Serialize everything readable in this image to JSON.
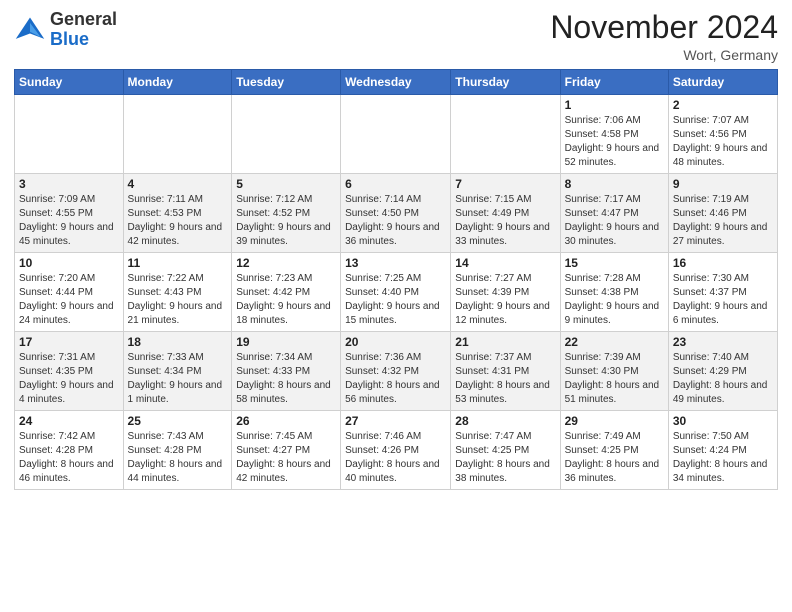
{
  "header": {
    "logo_general": "General",
    "logo_blue": "Blue",
    "month": "November 2024",
    "location": "Wort, Germany"
  },
  "days_of_week": [
    "Sunday",
    "Monday",
    "Tuesday",
    "Wednesday",
    "Thursday",
    "Friday",
    "Saturday"
  ],
  "weeks": [
    [
      {
        "day": "",
        "info": ""
      },
      {
        "day": "",
        "info": ""
      },
      {
        "day": "",
        "info": ""
      },
      {
        "day": "",
        "info": ""
      },
      {
        "day": "",
        "info": ""
      },
      {
        "day": "1",
        "info": "Sunrise: 7:06 AM\nSunset: 4:58 PM\nDaylight: 9 hours and 52 minutes."
      },
      {
        "day": "2",
        "info": "Sunrise: 7:07 AM\nSunset: 4:56 PM\nDaylight: 9 hours and 48 minutes."
      }
    ],
    [
      {
        "day": "3",
        "info": "Sunrise: 7:09 AM\nSunset: 4:55 PM\nDaylight: 9 hours and 45 minutes."
      },
      {
        "day": "4",
        "info": "Sunrise: 7:11 AM\nSunset: 4:53 PM\nDaylight: 9 hours and 42 minutes."
      },
      {
        "day": "5",
        "info": "Sunrise: 7:12 AM\nSunset: 4:52 PM\nDaylight: 9 hours and 39 minutes."
      },
      {
        "day": "6",
        "info": "Sunrise: 7:14 AM\nSunset: 4:50 PM\nDaylight: 9 hours and 36 minutes."
      },
      {
        "day": "7",
        "info": "Sunrise: 7:15 AM\nSunset: 4:49 PM\nDaylight: 9 hours and 33 minutes."
      },
      {
        "day": "8",
        "info": "Sunrise: 7:17 AM\nSunset: 4:47 PM\nDaylight: 9 hours and 30 minutes."
      },
      {
        "day": "9",
        "info": "Sunrise: 7:19 AM\nSunset: 4:46 PM\nDaylight: 9 hours and 27 minutes."
      }
    ],
    [
      {
        "day": "10",
        "info": "Sunrise: 7:20 AM\nSunset: 4:44 PM\nDaylight: 9 hours and 24 minutes."
      },
      {
        "day": "11",
        "info": "Sunrise: 7:22 AM\nSunset: 4:43 PM\nDaylight: 9 hours and 21 minutes."
      },
      {
        "day": "12",
        "info": "Sunrise: 7:23 AM\nSunset: 4:42 PM\nDaylight: 9 hours and 18 minutes."
      },
      {
        "day": "13",
        "info": "Sunrise: 7:25 AM\nSunset: 4:40 PM\nDaylight: 9 hours and 15 minutes."
      },
      {
        "day": "14",
        "info": "Sunrise: 7:27 AM\nSunset: 4:39 PM\nDaylight: 9 hours and 12 minutes."
      },
      {
        "day": "15",
        "info": "Sunrise: 7:28 AM\nSunset: 4:38 PM\nDaylight: 9 hours and 9 minutes."
      },
      {
        "day": "16",
        "info": "Sunrise: 7:30 AM\nSunset: 4:37 PM\nDaylight: 9 hours and 6 minutes."
      }
    ],
    [
      {
        "day": "17",
        "info": "Sunrise: 7:31 AM\nSunset: 4:35 PM\nDaylight: 9 hours and 4 minutes."
      },
      {
        "day": "18",
        "info": "Sunrise: 7:33 AM\nSunset: 4:34 PM\nDaylight: 9 hours and 1 minute."
      },
      {
        "day": "19",
        "info": "Sunrise: 7:34 AM\nSunset: 4:33 PM\nDaylight: 8 hours and 58 minutes."
      },
      {
        "day": "20",
        "info": "Sunrise: 7:36 AM\nSunset: 4:32 PM\nDaylight: 8 hours and 56 minutes."
      },
      {
        "day": "21",
        "info": "Sunrise: 7:37 AM\nSunset: 4:31 PM\nDaylight: 8 hours and 53 minutes."
      },
      {
        "day": "22",
        "info": "Sunrise: 7:39 AM\nSunset: 4:30 PM\nDaylight: 8 hours and 51 minutes."
      },
      {
        "day": "23",
        "info": "Sunrise: 7:40 AM\nSunset: 4:29 PM\nDaylight: 8 hours and 49 minutes."
      }
    ],
    [
      {
        "day": "24",
        "info": "Sunrise: 7:42 AM\nSunset: 4:28 PM\nDaylight: 8 hours and 46 minutes."
      },
      {
        "day": "25",
        "info": "Sunrise: 7:43 AM\nSunset: 4:28 PM\nDaylight: 8 hours and 44 minutes."
      },
      {
        "day": "26",
        "info": "Sunrise: 7:45 AM\nSunset: 4:27 PM\nDaylight: 8 hours and 42 minutes."
      },
      {
        "day": "27",
        "info": "Sunrise: 7:46 AM\nSunset: 4:26 PM\nDaylight: 8 hours and 40 minutes."
      },
      {
        "day": "28",
        "info": "Sunrise: 7:47 AM\nSunset: 4:25 PM\nDaylight: 8 hours and 38 minutes."
      },
      {
        "day": "29",
        "info": "Sunrise: 7:49 AM\nSunset: 4:25 PM\nDaylight: 8 hours and 36 minutes."
      },
      {
        "day": "30",
        "info": "Sunrise: 7:50 AM\nSunset: 4:24 PM\nDaylight: 8 hours and 34 minutes."
      }
    ]
  ]
}
